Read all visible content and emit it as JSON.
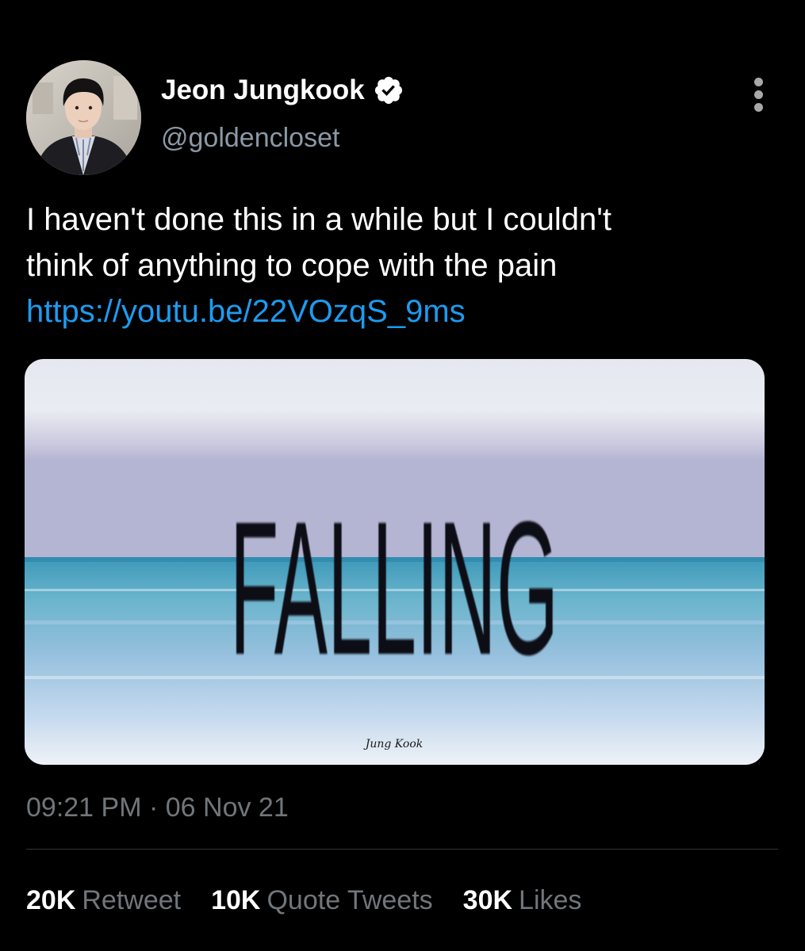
{
  "tweet": {
    "author": {
      "display_name": "Jeon Jungkook",
      "handle": "@goldencloset",
      "verified": true
    },
    "text_lines": [
      "I haven't done this in a while but I couldn't",
      "think of anything to cope with the pain"
    ],
    "link": "https://youtu.be/22VOzqS_9ms",
    "media": {
      "title": "FALLING",
      "signature": "Jung Kook"
    },
    "timestamp": "09:21 PM · 06 Nov 21",
    "stats": [
      {
        "count": "20K",
        "label": "Retweet"
      },
      {
        "count": "10K",
        "label": "Quote Tweets"
      },
      {
        "count": "30K",
        "label": "Likes"
      }
    ]
  },
  "icons": {
    "verified": "verified-badge-icon",
    "more": "more-vertical-icon"
  },
  "colors": {
    "background": "#000000",
    "link": "#1d9bf0",
    "secondary_text": "#71767b",
    "divider": "#2f3336"
  }
}
